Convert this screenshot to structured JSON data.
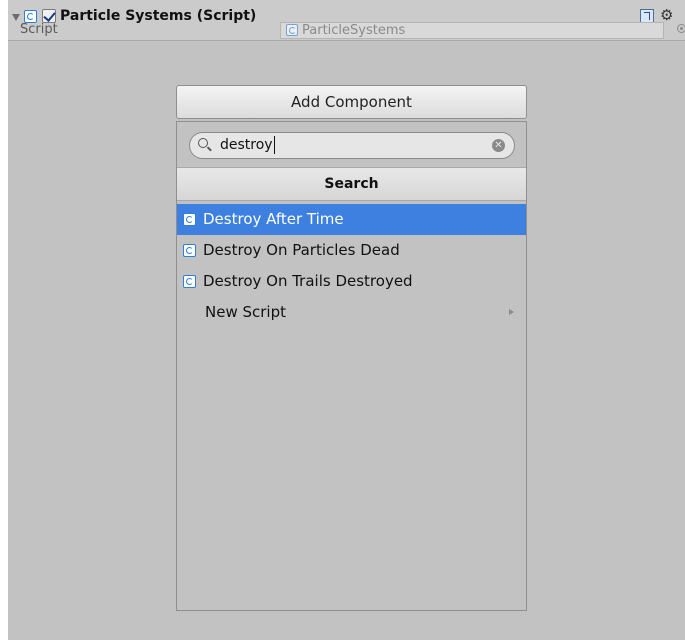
{
  "header": {
    "title": "Particle Systems (Script)",
    "script_label": "Script",
    "script_value": "ParticleSystems",
    "enabled": true
  },
  "add_component": {
    "button_label": "Add Component",
    "search_value": "destroy",
    "search_header": "Search",
    "items": [
      {
        "label": "Destroy After Time",
        "icon": "script-icon",
        "selected": true
      },
      {
        "label": "Destroy On Particles Dead",
        "icon": "script-icon",
        "selected": false
      },
      {
        "label": "Destroy On Trails Destroyed",
        "icon": "script-icon",
        "selected": false
      }
    ],
    "new_script_label": "New Script"
  },
  "colors": {
    "selection": "#3d80df",
    "panel_bg": "#c2c2c2"
  }
}
